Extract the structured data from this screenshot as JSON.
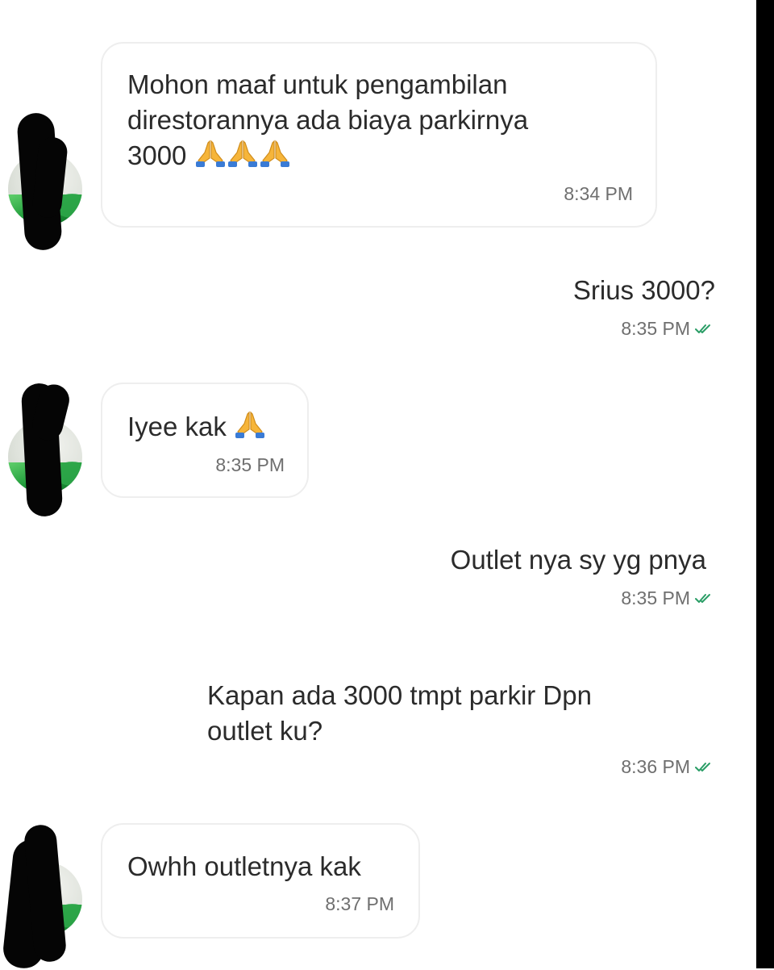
{
  "chat": {
    "messages": [
      {
        "direction": "incoming",
        "lines": [
          "Mohon maaf untuk pengambilan",
          "direstorannya ada biaya parkirnya",
          "3000"
        ],
        "emoji": [
          "folded-hands",
          "folded-hands",
          "folded-hands"
        ],
        "time": "8:34 PM"
      },
      {
        "direction": "outgoing",
        "lines": [
          "Srius 3000?"
        ],
        "time": "8:35 PM",
        "status": "read-double-check"
      },
      {
        "direction": "incoming",
        "lines": [
          "Iyee kak"
        ],
        "emoji": [
          "folded-hands"
        ],
        "time": "8:35 PM"
      },
      {
        "direction": "outgoing",
        "lines": [
          "Outlet nya sy yg pnya"
        ],
        "time": "8:35 PM",
        "status": "read-double-check"
      },
      {
        "direction": "outgoing",
        "lines": [
          "Kapan ada 3000 tmpt parkir Dpn",
          "outlet ku?"
        ],
        "time": "8:36 PM",
        "status": "read-double-check"
      },
      {
        "direction": "incoming",
        "lines": [
          "Owhh outletnya kak"
        ],
        "time": "8:37 PM"
      }
    ]
  },
  "colors": {
    "background": "#ffffff",
    "bubble_border": "#eeeeee",
    "text": "#2b2b2b",
    "time": "#6f6f6f",
    "read_check": "#2a9d66",
    "emoji": "#f6b53a"
  }
}
